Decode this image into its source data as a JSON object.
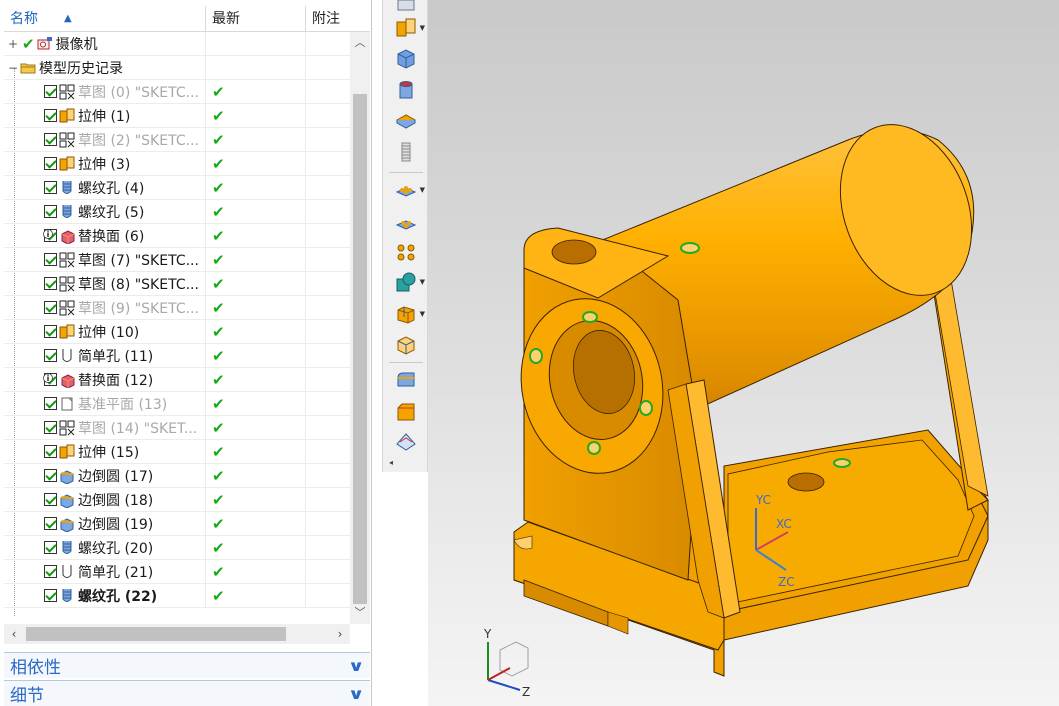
{
  "navigator": {
    "columns": {
      "name": "名称",
      "latest": "最新",
      "note": "附注"
    },
    "rows": [
      {
        "label": "摄像机",
        "state": "",
        "icon": "camera-icon",
        "expander": "+",
        "latest": ""
      },
      {
        "label": "模型历史记录",
        "state": "",
        "icon": "folder-icon",
        "expander": "−",
        "latest": ""
      },
      {
        "label": "草图 (0) \"SKETC...",
        "state": "dim",
        "icon": "sketch-icon",
        "latest": "✔"
      },
      {
        "label": "拉伸 (1)",
        "state": "",
        "icon": "extrude-icon",
        "latest": "✔"
      },
      {
        "label": "草图 (2) \"SKETC...",
        "state": "dim",
        "icon": "sketch-icon",
        "latest": "✔"
      },
      {
        "label": "拉伸 (3)",
        "state": "",
        "icon": "extrude-icon",
        "latest": "✔"
      },
      {
        "label": "螺纹孔 (4)",
        "state": "",
        "icon": "threaded-hole-icon",
        "latest": "✔"
      },
      {
        "label": "螺纹孔 (5)",
        "state": "",
        "icon": "threaded-hole-icon",
        "latest": "✔"
      },
      {
        "label": "替换面 (6)",
        "state": "",
        "icon": "replace-face-icon",
        "latest": "✔"
      },
      {
        "label": "草图 (7) \"SKETC...",
        "state": "",
        "icon": "sketch-icon",
        "latest": "✔"
      },
      {
        "label": "草图 (8) \"SKETC...",
        "state": "",
        "icon": "sketch-icon",
        "latest": "✔"
      },
      {
        "label": "草图 (9) \"SKETC...",
        "state": "dim",
        "icon": "sketch-icon",
        "latest": "✔"
      },
      {
        "label": "拉伸 (10)",
        "state": "",
        "icon": "extrude-icon",
        "latest": "✔"
      },
      {
        "label": "简单孔 (11)",
        "state": "",
        "icon": "simple-hole-icon",
        "latest": "✔"
      },
      {
        "label": "替换面 (12)",
        "state": "",
        "icon": "replace-face-icon",
        "latest": "✔"
      },
      {
        "label": "基准平面 (13)",
        "state": "dim",
        "icon": "datum-plane-icon",
        "latest": "✔"
      },
      {
        "label": "草图 (14) \"SKET...",
        "state": "dim",
        "icon": "sketch-icon",
        "latest": "✔"
      },
      {
        "label": "拉伸 (15)",
        "state": "",
        "icon": "extrude-icon",
        "latest": "✔"
      },
      {
        "label": "边倒圆 (17)",
        "state": "",
        "icon": "edge-blend-icon",
        "latest": "✔"
      },
      {
        "label": "边倒圆 (18)",
        "state": "",
        "icon": "edge-blend-icon",
        "latest": "✔"
      },
      {
        "label": "边倒圆 (19)",
        "state": "",
        "icon": "edge-blend-icon",
        "latest": "✔"
      },
      {
        "label": "螺纹孔 (20)",
        "state": "",
        "icon": "threaded-hole-icon",
        "latest": "✔"
      },
      {
        "label": "简单孔 (21)",
        "state": "",
        "icon": "simple-hole-icon",
        "latest": "✔"
      },
      {
        "label": "螺纹孔 (22)",
        "state": "bold",
        "icon": "threaded-hole-icon",
        "latest": "✔"
      }
    ],
    "panels": [
      {
        "title": "相依性",
        "icon": "chevron-down-icon"
      },
      {
        "title": "细节",
        "icon": "chevron-down-icon"
      }
    ]
  },
  "colors": {
    "accent": "#2a6ac6",
    "check": "#18a818",
    "model": "#f5a300"
  },
  "viewport": {
    "csys": {
      "yc": "YC",
      "xc": "XC",
      "zc": "ZC"
    },
    "triad": {
      "y": "Y",
      "z": "Z"
    }
  }
}
